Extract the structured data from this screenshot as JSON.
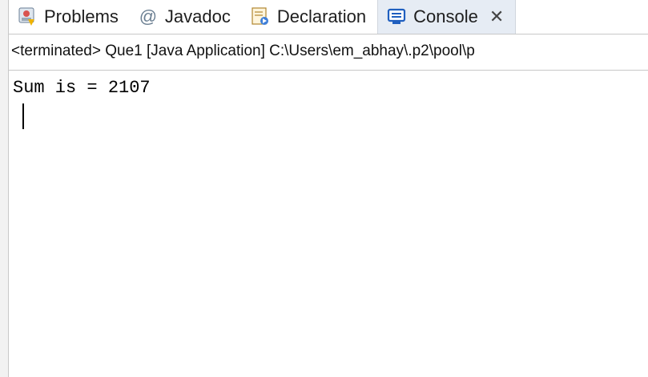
{
  "tabs": [
    {
      "label": "Problems",
      "icon": "problems-icon"
    },
    {
      "label": "Javadoc",
      "icon": "at-icon",
      "icon_glyph": "@"
    },
    {
      "label": "Declaration",
      "icon": "declaration-icon"
    },
    {
      "label": "Console",
      "icon": "console-icon",
      "active": true,
      "close_glyph": "✕"
    }
  ],
  "info_bar": {
    "text": "<terminated> Que1 [Java Application] C:\\Users\\em_abhay\\.p2\\pool\\p"
  },
  "console": {
    "lines": [
      "Sum is = 2107"
    ]
  },
  "colors": {
    "active_tab_bg": "#e6ecf4",
    "gutter_bg": "#f2f2f2",
    "border": "#c8c8c8"
  }
}
